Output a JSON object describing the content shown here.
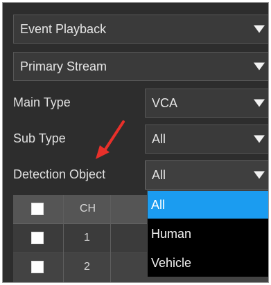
{
  "playback_mode": {
    "value": "Event Playback"
  },
  "stream": {
    "value": "Primary Stream"
  },
  "main_type": {
    "label": "Main Type",
    "value": "VCA"
  },
  "sub_type": {
    "label": "Sub Type",
    "value": "All"
  },
  "detection_object": {
    "label": "Detection Object",
    "value": "All",
    "options": [
      "All",
      "Human",
      "Vehicle"
    ],
    "selected_index": 0
  },
  "channel_table": {
    "header": {
      "ch": "CH"
    },
    "rows": [
      {
        "ch": "1"
      },
      {
        "ch": "2"
      }
    ]
  },
  "colors": {
    "selection": "#1b9cf0",
    "arrow": "#e8302a",
    "panel": "#2d2d2d"
  }
}
